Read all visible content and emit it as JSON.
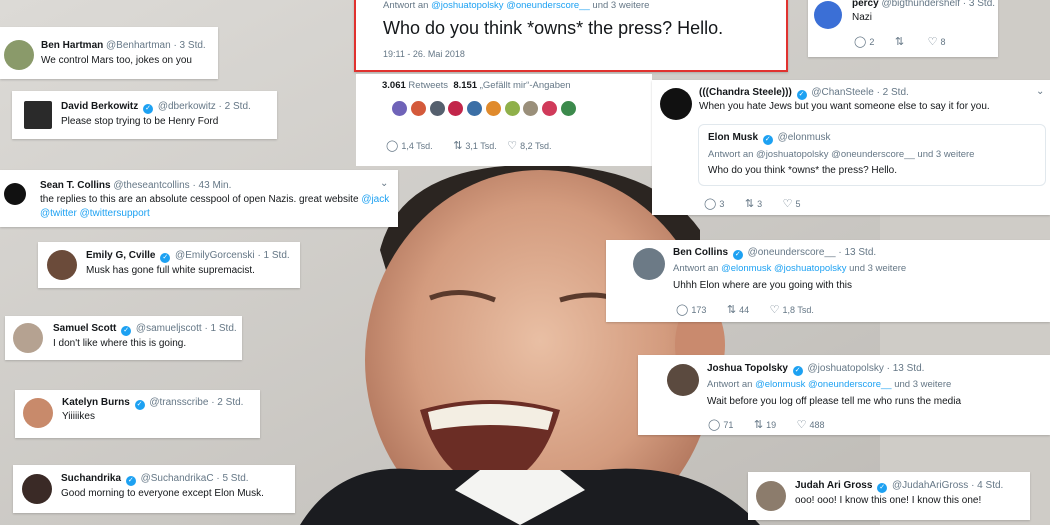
{
  "main_tweet": {
    "reply_to_prefix": "Antwort an",
    "reply_to_users": "@joshuatopolsky @oneunderscore__",
    "reply_to_more": "und 3 weitere",
    "text": "Who do you think *owns* the press? Hello.",
    "timestamp": "19:11 - 26. Mai 2018",
    "retweets_count": "3.061",
    "retweets_label": "Retweets",
    "likes_count": "8.151",
    "likes_label": "„Gefällt mir“-Angaben",
    "action_replies": "1,4 Tsd.",
    "action_retweets": "3,1 Tsd.",
    "action_likes": "8,2 Tsd."
  },
  "tweets": {
    "ben_hartman": {
      "name": "Ben Hartman",
      "handle": "@Benhartman",
      "time": "· 3 Std.",
      "text": "We control Mars too, jokes on you"
    },
    "david_berkowitz": {
      "name": "David Berkowitz",
      "handle": "@dberkowitz",
      "time": "· 2 Std.",
      "text": "Please stop trying to be Henry Ford"
    },
    "sean_collins": {
      "name": "Sean T. Collins",
      "handle": "@theseantcollins",
      "time": "· 43 Min.",
      "text": "the replies to this are an absolute cesspool of open Nazis. great website",
      "mention1": "@jack",
      "mention2": "@twitter",
      "mention3": "@twittersupport"
    },
    "emily": {
      "name": "Emily G, Cville",
      "handle": "@EmilyGorcenski",
      "time": "· 1 Std.",
      "text": "Musk has gone full white supremacist."
    },
    "samuel_scott": {
      "name": "Samuel Scott",
      "handle": "@samueljscott",
      "time": "· 1 Std.",
      "text": "I don't like where this is going."
    },
    "katelyn_burns": {
      "name": "Katelyn Burns",
      "handle": "@transscribe",
      "time": "· 2 Std.",
      "text": "Yiiiiikes"
    },
    "suchandrika": {
      "name": "Suchandrika",
      "handle": "@SuchandrikaC",
      "time": "· 5 Std.",
      "text": "Good morning to everyone except Elon Musk."
    },
    "percy": {
      "name": "percy",
      "handle": "@bigthundershelf",
      "time": "· 3 Std.",
      "text": "Nazi",
      "replies": "2",
      "retweets": "",
      "likes": "8"
    },
    "chandra": {
      "name": "(((Chandra Steele)))",
      "handle": "@ChanSteele",
      "time": "· 2 Std.",
      "text": "When you hate Jews but you want someone else to say it for you.",
      "quoted_name": "Elon Musk",
      "quoted_handle": "@elonmusk",
      "quoted_reply": "Antwort an @joshuatopolsky @oneunderscore__ und 3 weitere",
      "quoted_text": "Who do you think *owns* the press? Hello.",
      "replies": "3",
      "retweets": "3",
      "likes": "5"
    },
    "ben_collins": {
      "name": "Ben Collins",
      "handle": "@oneunderscore__",
      "time": "· 13 Std.",
      "reply_prefix": "Antwort an",
      "reply_users": "@elonmusk @joshuatopolsky",
      "reply_more": "und 3 weitere",
      "text": "Uhhh Elon where are you going with this",
      "replies": "173",
      "retweets": "44",
      "likes": "1,8 Tsd."
    },
    "joshua_topolsky": {
      "name": "Joshua Topolsky",
      "handle": "@joshuatopolsky",
      "time": "· 13 Std.",
      "reply_prefix": "Antwort an",
      "reply_users": "@elonmusk @oneunderscore__",
      "reply_more": "und 3 weitere",
      "text": "Wait before you log off please tell me who runs the media",
      "replies": "71",
      "retweets": "19",
      "likes": "488"
    },
    "judah": {
      "name": "Judah Ari Gross",
      "handle": "@JudahAriGross",
      "time": "· 4 Std.",
      "text": "ooo! ooo! I know this one! I know this one!"
    }
  },
  "icons": {
    "reply": "reply-icon",
    "retweet": "retweet-icon",
    "like": "heart-icon",
    "verified": "verified-badge-icon",
    "chevron": "chevron-down-icon"
  },
  "colors": {
    "accent": "#1da1f2",
    "main_border": "#e0322f"
  }
}
